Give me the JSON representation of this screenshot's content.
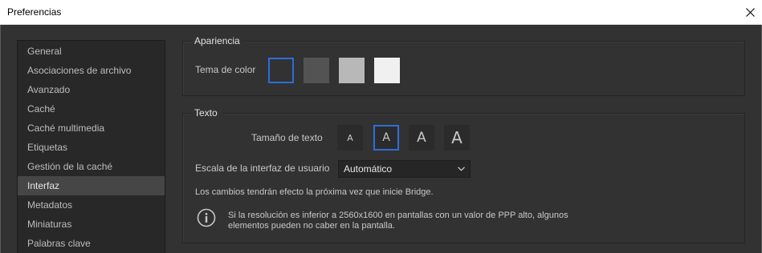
{
  "window": {
    "title": "Preferencias"
  },
  "sidebar": {
    "items": [
      {
        "label": "General"
      },
      {
        "label": "Asociaciones de archivo"
      },
      {
        "label": "Avanzado"
      },
      {
        "label": "Caché"
      },
      {
        "label": "Caché multimedia"
      },
      {
        "label": "Etiquetas"
      },
      {
        "label": "Gestión de la caché"
      },
      {
        "label": "Interfaz"
      },
      {
        "label": "Metadatos"
      },
      {
        "label": "Miniaturas"
      },
      {
        "label": "Palabras clave"
      }
    ],
    "selected": "Interfaz"
  },
  "appearance": {
    "legend": "Apariencia",
    "color_theme_label": "Tema de color",
    "swatches": [
      {
        "name": "darkest",
        "color": "#323232",
        "selected": true
      },
      {
        "name": "dark",
        "color": "#535353",
        "selected": false
      },
      {
        "name": "light",
        "color": "#b8b8b8",
        "selected": false
      },
      {
        "name": "lightest",
        "color": "#f0f0f0",
        "selected": false
      }
    ],
    "accent_color": "#2d6ed8"
  },
  "text": {
    "legend": "Texto",
    "size_label": "Tamaño de texto",
    "size_buttons": [
      {
        "glyph": "A",
        "selected": false
      },
      {
        "glyph": "A",
        "selected": true
      },
      {
        "glyph": "A",
        "selected": false
      },
      {
        "glyph": "A",
        "selected": false
      }
    ],
    "ui_scale_label": "Escala de la interfaz de usuario",
    "ui_scale_value": "Automático",
    "restart_note": "Los cambios tendrán efecto la próxima vez que inicie Bridge.",
    "info_line1": "Si la resolución es inferior a 2560x1600 en pantallas con un valor de PPP alto, algunos",
    "info_line2": "elementos pueden no caber en la pantalla."
  }
}
